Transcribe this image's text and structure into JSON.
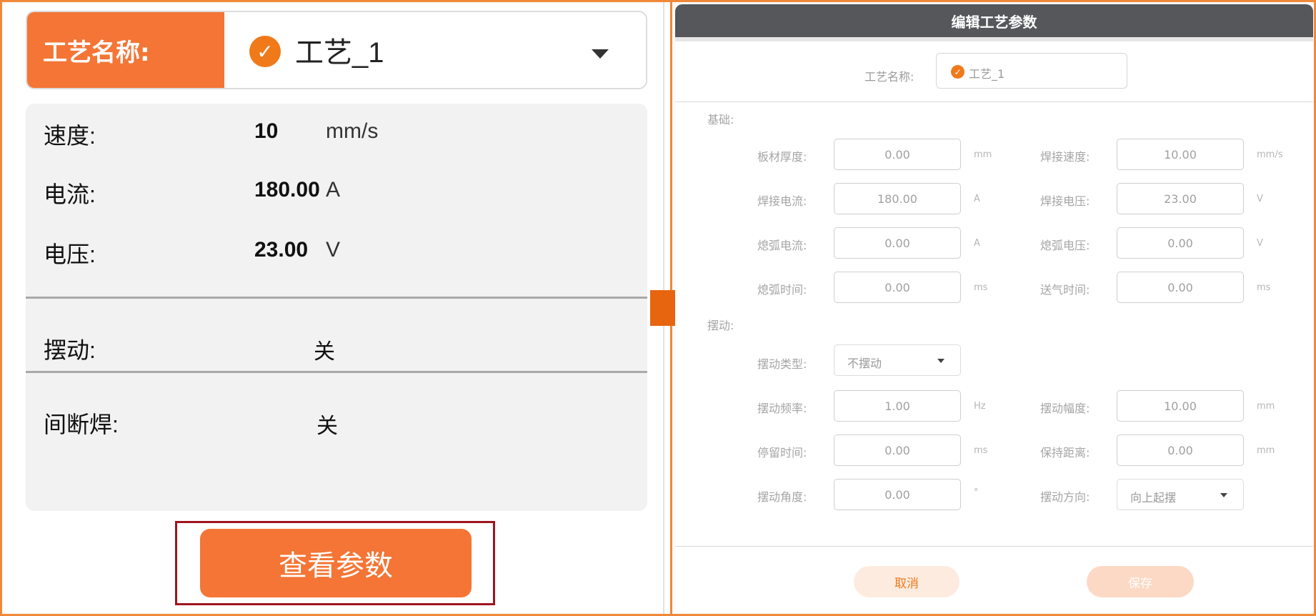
{
  "left": {
    "process_label": "工艺名称:",
    "process_value": "工艺_1",
    "speed": {
      "label": "速度:",
      "value": "10",
      "unit": "mm/s"
    },
    "current": {
      "label": "电流:",
      "value": "180.00",
      "unit": "A"
    },
    "voltage": {
      "label": "电压:",
      "value": "23.00",
      "unit": "V"
    },
    "weave": {
      "label": "摆动:",
      "value": "关"
    },
    "stitch": {
      "label": "间断焊:",
      "value": "关"
    },
    "view_button": "查看参数"
  },
  "dialog": {
    "title": "编辑工艺参数",
    "name_label": "工艺名称:",
    "name_value": "工艺_1",
    "basic_title": "基础:",
    "weave_title": "摆动:",
    "fields": {
      "plate_thickness": {
        "label": "板材厚度:",
        "value": "0.00",
        "unit": "mm"
      },
      "weld_speed": {
        "label": "焊接速度:",
        "value": "10.00",
        "unit": "mm/s"
      },
      "weld_current": {
        "label": "焊接电流:",
        "value": "180.00",
        "unit": "A"
      },
      "weld_voltage": {
        "label": "焊接电压:",
        "value": "23.00",
        "unit": "V"
      },
      "crater_current": {
        "label": "熄弧电流:",
        "value": "0.00",
        "unit": "A"
      },
      "crater_voltage": {
        "label": "熄弧电压:",
        "value": "0.00",
        "unit": "V"
      },
      "crater_time": {
        "label": "熄弧时间:",
        "value": "0.00",
        "unit": "ms"
      },
      "gas_time": {
        "label": "送气时间:",
        "value": "0.00",
        "unit": "ms"
      },
      "weave_type": {
        "label": "摆动类型:",
        "value": "不摆动"
      },
      "weave_freq": {
        "label": "摆动频率:",
        "value": "1.00",
        "unit": "Hz"
      },
      "weave_amp": {
        "label": "摆动幅度:",
        "value": "10.00",
        "unit": "mm"
      },
      "dwell_time": {
        "label": "停留时间:",
        "value": "0.00",
        "unit": "ms"
      },
      "hold_dist": {
        "label": "保持距离:",
        "value": "0.00",
        "unit": "mm"
      },
      "weave_angle": {
        "label": "摆动角度:",
        "value": "0.00",
        "unit": "°"
      },
      "weave_dir": {
        "label": "摆动方向:",
        "value": "向上起摆"
      }
    },
    "cancel_button": "取消",
    "save_button": "保存"
  },
  "colors": {
    "accent": "#f47535",
    "header": "#55575b",
    "frame": "#f0883a",
    "highlight_box": "#a0141e"
  }
}
